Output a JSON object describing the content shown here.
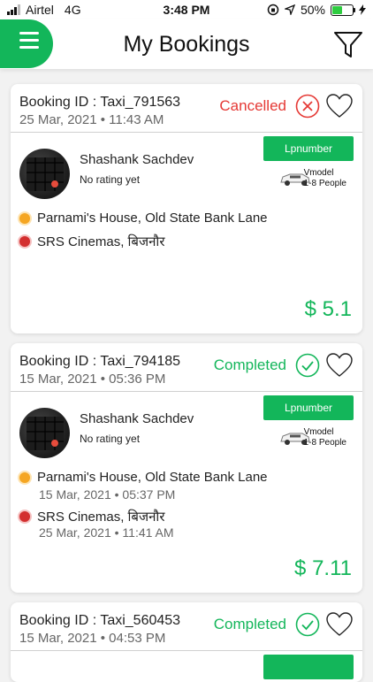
{
  "status_bar": {
    "carrier": "Airtel",
    "network": "4G",
    "time": "3:48 PM",
    "battery": "50%",
    "battery_level": 0.5
  },
  "header": {
    "title": "My Bookings",
    "brand_color": "#13b65a"
  },
  "bookings": [
    {
      "id": "Booking ID : Taxi_791563",
      "date": "25 Mar, 2021 • 11:43 AM",
      "status": "Cancelled",
      "status_color": "#e53935",
      "status_icon": "cancel-circle-icon",
      "driver": "Shashank Sachdev",
      "rating": "No rating yet",
      "plate": "Lpnumber",
      "vehicle_model": "Vmodel",
      "capacity": "1-8 People",
      "pickup": "Parnami's House,  Old State Bank Lane",
      "pickup_time": "",
      "drop": "SRS Cinemas,  बिजनौर",
      "drop_time": "",
      "price": "$ 5.1"
    },
    {
      "id": "Booking ID : Taxi_794185",
      "date": "15 Mar, 2021 • 05:36 PM",
      "status": "Completed",
      "status_color": "#13b65a",
      "status_icon": "check-circle-icon",
      "driver": "Shashank Sachdev",
      "rating": "No rating yet",
      "plate": "Lpnumber",
      "vehicle_model": "Vmodel",
      "capacity": "1-8 People",
      "pickup": "Parnami's House,  Old State Bank Lane",
      "pickup_time": "15 Mar, 2021 • 05:37 PM",
      "drop": "SRS Cinemas,  बिजनौर",
      "drop_time": "25 Mar, 2021 • 11:41 AM",
      "price": "$ 7.11"
    },
    {
      "id": "Booking ID : Taxi_560453",
      "date": "15 Mar, 2021 • 04:53 PM",
      "status": "Completed",
      "status_color": "#13b65a",
      "status_icon": "check-circle-icon"
    }
  ]
}
